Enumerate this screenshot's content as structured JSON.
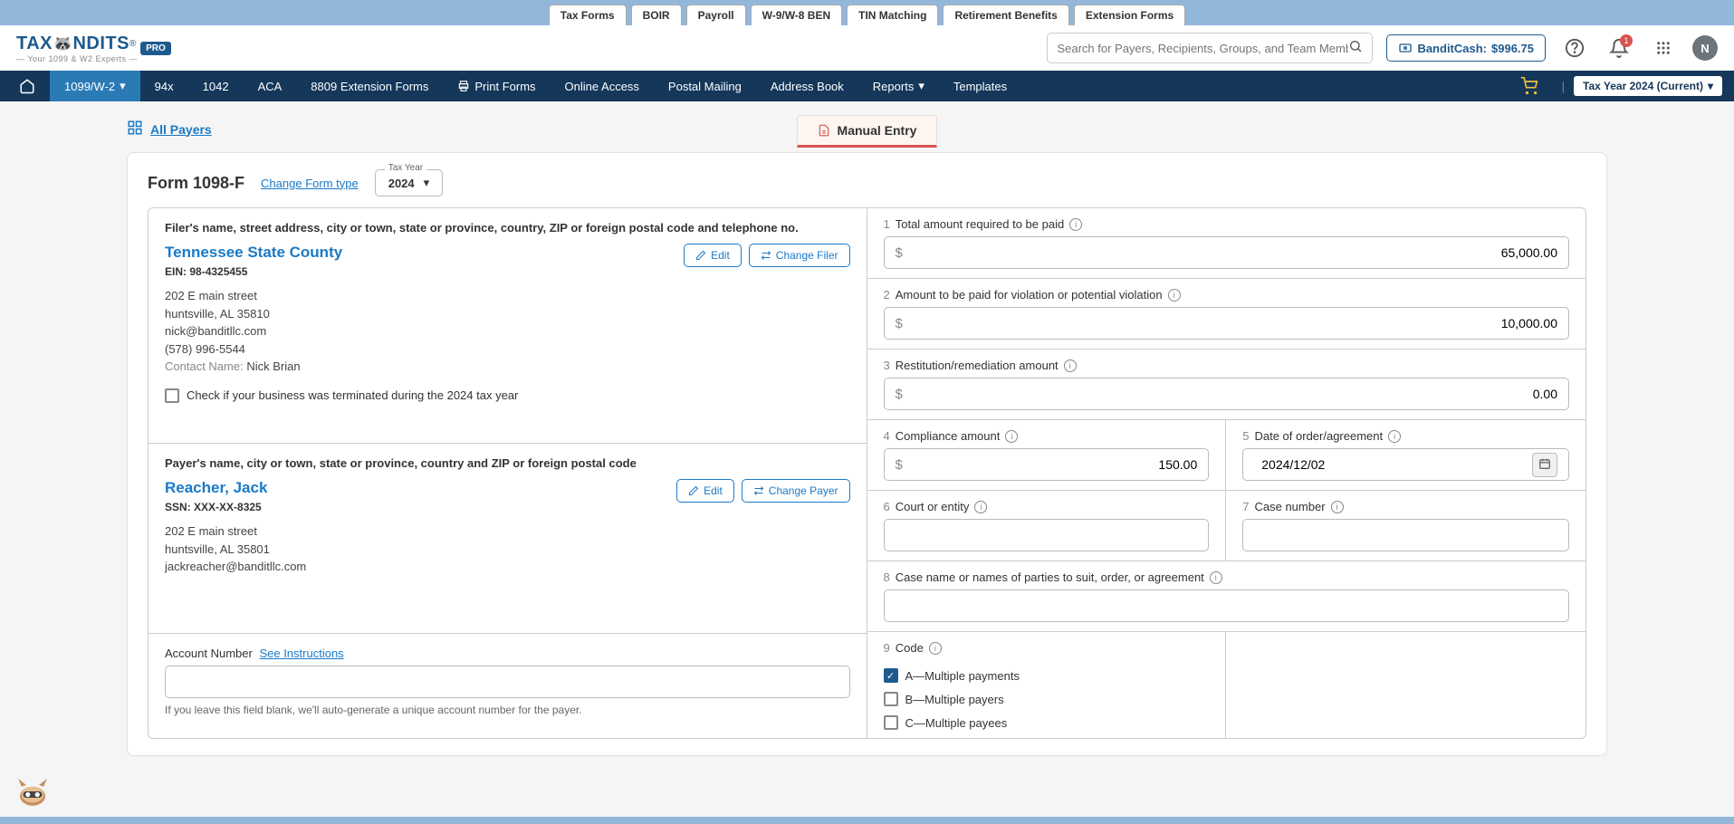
{
  "topTabs": [
    "Tax Forms",
    "BOIR",
    "Payroll",
    "W-9/W-8 BEN",
    "TIN Matching",
    "Retirement Benefits",
    "Extension Forms"
  ],
  "logo": {
    "t1": "TAX",
    "t2": "NDITS",
    "sub": "— Your 1099 & W2 Experts —",
    "pro": "PRO",
    "reg": "®"
  },
  "search": {
    "placeholder": "Search for Payers, Recipients, Groups, and Team Members"
  },
  "banditCash": {
    "label": "BanditCash:",
    "amount": "$996.75"
  },
  "notif": "1",
  "avatar": "N",
  "nav": {
    "items": [
      "1099/W-2",
      "94x",
      "1042",
      "ACA",
      "8809 Extension Forms",
      "Print Forms",
      "Online Access",
      "Postal Mailing",
      "Address Book",
      "Reports",
      "Templates"
    ],
    "active": 0,
    "taxYear": "Tax Year 2024 (Current)"
  },
  "breadcrumb": "All Payers",
  "manualTab": "Manual Entry",
  "formTitle": "Form 1098-F",
  "changeForm": "Change Form type",
  "yearLabel": "Tax Year",
  "yearValue": "2024",
  "filer": {
    "sectLabel": "Filer's name, street address, city or town, state or province, country, ZIP or foreign postal code and telephone no.",
    "name": "Tennessee State County",
    "einLabel": "EIN:",
    "ein": "98-4325455",
    "addr1": "202 E main street",
    "addr2": "huntsville, AL 35810",
    "email": "nick@banditllc.com",
    "phone": "(578) 996-5544",
    "contactLabel": "Contact Name:",
    "contactName": "Nick Brian",
    "editBtn": "Edit",
    "changeBtn": "Change Filer",
    "checkText": "Check if your business was terminated during the 2024 tax year"
  },
  "payer": {
    "sectLabel": "Payer's name, city or town, state or province, country and ZIP or foreign postal code",
    "name": "Reacher, Jack",
    "ssnLabel": "SSN:",
    "ssn": "XXX-XX-8325",
    "addr1": "202 E main street",
    "addr2": "huntsville, AL 35801",
    "email": "jackreacher@banditllc.com",
    "editBtn": "Edit",
    "changeBtn": "Change Payer"
  },
  "account": {
    "label": "Account Number",
    "seeLink": "See Instructions",
    "help": "If you leave this field blank, we'll auto-generate a unique account number for the payer."
  },
  "fields": {
    "b1": {
      "num": "1",
      "label": "Total amount required to be paid",
      "value": "65,000.00"
    },
    "b2": {
      "num": "2",
      "label": "Amount to be paid for violation or potential violation",
      "value": "10,000.00"
    },
    "b3": {
      "num": "3",
      "label": "Restitution/remediation amount",
      "value": "0.00"
    },
    "b4": {
      "num": "4",
      "label": "Compliance amount",
      "value": "150.00"
    },
    "b5": {
      "num": "5",
      "label": "Date of order/agreement",
      "value": "2024/12/02"
    },
    "b6": {
      "num": "6",
      "label": "Court or entity",
      "value": ""
    },
    "b7": {
      "num": "7",
      "label": "Case number",
      "value": ""
    },
    "b8": {
      "num": "8",
      "label": "Case name or names of parties to suit, order, or agreement",
      "value": ""
    },
    "b9": {
      "num": "9",
      "label": "Code"
    }
  },
  "codes": [
    {
      "label": "A—Multiple payments",
      "checked": true
    },
    {
      "label": "B—Multiple payers",
      "checked": false
    },
    {
      "label": "C—Multiple payees",
      "checked": false
    }
  ]
}
